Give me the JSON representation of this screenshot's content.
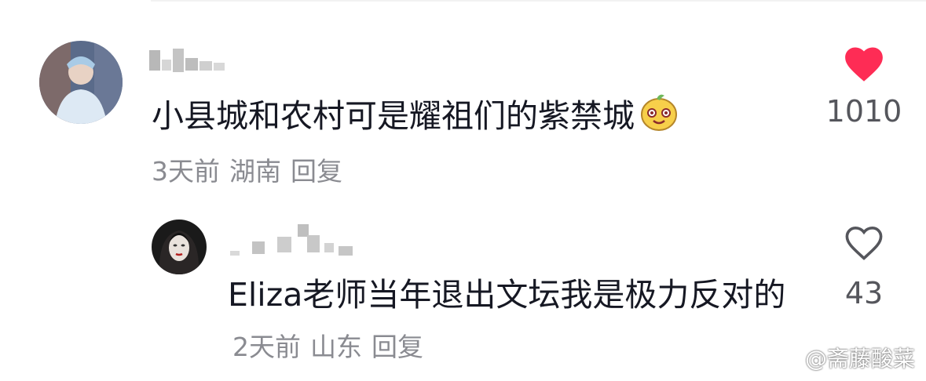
{
  "comments": [
    {
      "text": "小县城和农村可是耀祖们的紫禁城",
      "emoji_icon": "yellow-face-emoji",
      "time": "3天前",
      "location": "湖南",
      "reply_label": "回复",
      "likes": "1010",
      "liked": true,
      "like_color": "#fe2c55"
    },
    {
      "text": "Eliza老师当年退出文坛我是极力反对的",
      "time": "2天前",
      "location": "山东",
      "reply_label": "回复",
      "likes": "43",
      "liked": false
    }
  ],
  "watermark": {
    "text": "@斋藤酸菜",
    "icon": "weibo-icon"
  }
}
